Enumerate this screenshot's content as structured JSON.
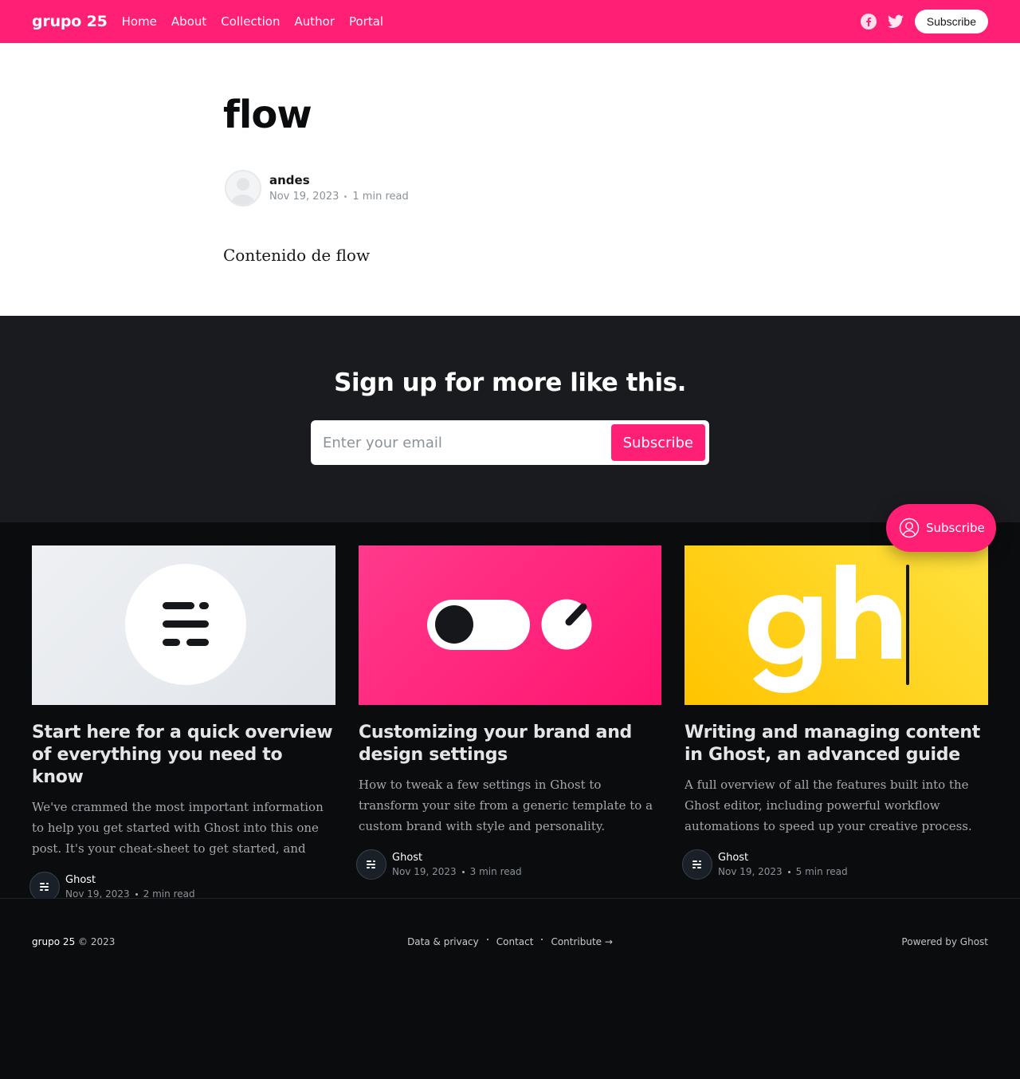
{
  "site": {
    "title": "grupo 25",
    "nav": [
      "Home",
      "About",
      "Collection",
      "Author",
      "Portal"
    ],
    "subscribe_label": "Subscribe",
    "brand_color": "#ff1f74",
    "social_icons": [
      "facebook-icon",
      "twitter-icon"
    ]
  },
  "article": {
    "title": "flow",
    "author": "andes",
    "date": "Nov 19, 2023",
    "reading_time": "1 min read",
    "content": "Contenido de flow"
  },
  "cta": {
    "title": "Sign up for more like this.",
    "email_placeholder": "Enter your email",
    "button_label": "Subscribe"
  },
  "posts": [
    {
      "title": "Start here for a quick overview of everything you need to know",
      "excerpt": "We've crammed the most important information to help you get started with Ghost into this one post. It's your cheat-sheet to get started, and your shortcut to…",
      "author": "Ghost",
      "date": "Nov 19, 2023",
      "reading_time": "2 min read"
    },
    {
      "title": "Customizing your brand and design settings",
      "excerpt": "How to tweak a few settings in Ghost to transform your site from a generic template to a custom brand with style and personality.",
      "author": "Ghost",
      "date": "Nov 19, 2023",
      "reading_time": "3 min read"
    },
    {
      "title": "Writing and managing content in Ghost, an advanced guide",
      "excerpt": "A full overview of all the features built into the Ghost editor, including powerful workflow automations to speed up your creative process.",
      "author": "Ghost",
      "date": "Nov 19, 2023",
      "reading_time": "5 min read"
    }
  ],
  "portal": {
    "label": "Subscribe"
  },
  "footer": {
    "brand": "grupo 25",
    "copyright": "© 2023",
    "links": [
      "Data & privacy",
      "Contact",
      "Contribute →"
    ],
    "powered_by": "Powered by Ghost"
  }
}
